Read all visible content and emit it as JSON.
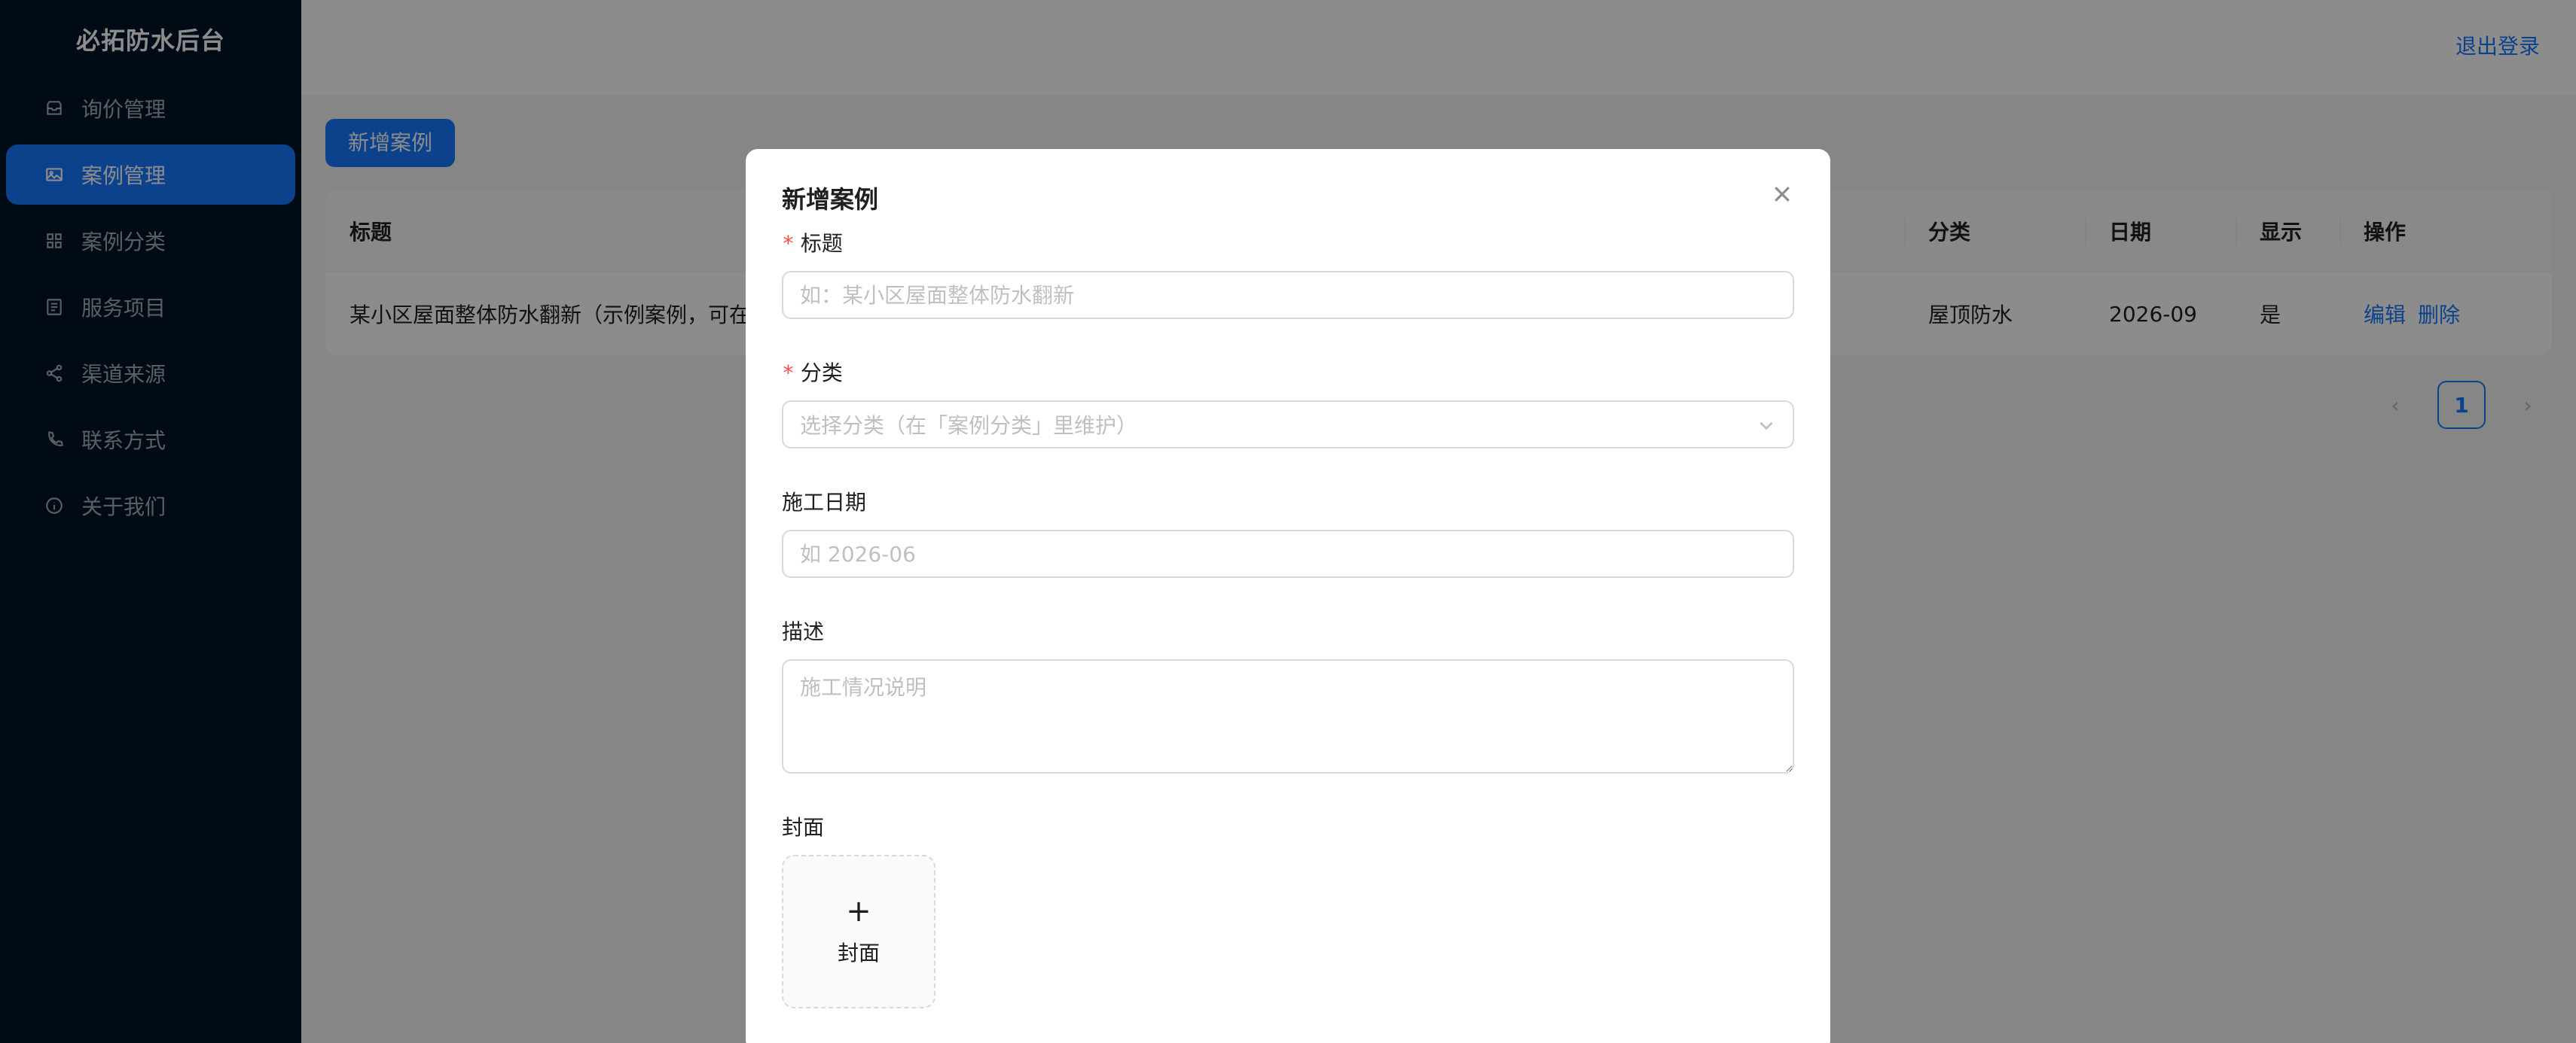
{
  "sidebar": {
    "brand": "必拓防水后台",
    "items": [
      {
        "label": "询价管理",
        "icon": "inbox-icon"
      },
      {
        "label": "案例管理",
        "icon": "picture-icon",
        "active": true
      },
      {
        "label": "案例分类",
        "icon": "appstore-icon"
      },
      {
        "label": "服务项目",
        "icon": "list-icon"
      },
      {
        "label": "渠道来源",
        "icon": "share-icon"
      },
      {
        "label": "联系方式",
        "icon": "phone-icon"
      },
      {
        "label": "关于我们",
        "icon": "info-icon"
      }
    ]
  },
  "header": {
    "logout": "退出登录"
  },
  "toolbar": {
    "add_case": "新增案例"
  },
  "table": {
    "columns": {
      "title": "标题",
      "category": "分类",
      "date": "日期",
      "show": "显示",
      "actions": "操作"
    },
    "rows": [
      {
        "title": "某小区屋面整体防水翻新（示例案例，可在",
        "category": "屋顶防水",
        "date": "2026-09",
        "show": "是",
        "edit": "编辑",
        "delete": "删除"
      }
    ]
  },
  "pagination": {
    "current": "1",
    "prev": "‹",
    "next": "›"
  },
  "modal": {
    "title": "新增案例",
    "fields": {
      "title": {
        "required_mark": "*",
        "label": "标题",
        "placeholder": "如：某小区屋面整体防水翻新"
      },
      "category": {
        "required_mark": "*",
        "label": "分类",
        "placeholder": "选择分类（在「案例分类」里维护）"
      },
      "date": {
        "label": "施工日期",
        "placeholder": "如 2026-06"
      },
      "description": {
        "label": "描述",
        "placeholder": "施工情况说明"
      },
      "cover": {
        "label": "封面",
        "upload_plus": "+",
        "upload_label": "封面"
      }
    }
  },
  "colors": {
    "primary": "#1677ff",
    "sidebar_bg": "#001529",
    "danger": "#ff4d4f"
  }
}
